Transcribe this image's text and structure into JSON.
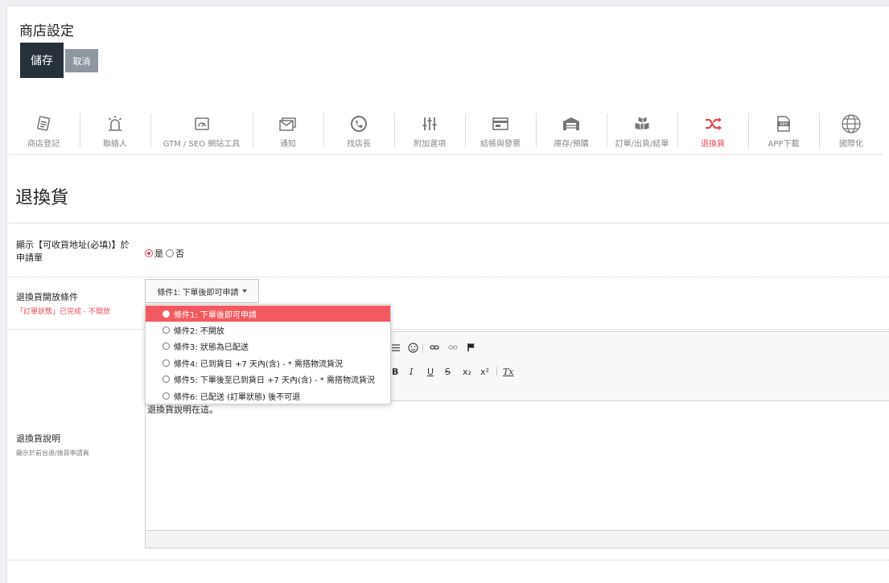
{
  "header": {
    "title": "商店設定",
    "save_label": "儲存",
    "cancel_label": "取消"
  },
  "toolbar": {
    "items": [
      {
        "label": "商店登記",
        "icon": "register-icon"
      },
      {
        "label": "聯絡人",
        "icon": "alarm-icon"
      },
      {
        "label": "GTM / SEO 網站工具",
        "icon": "dashboard-icon"
      },
      {
        "label": "通知",
        "icon": "mail-icon"
      },
      {
        "label": "找店長",
        "icon": "phone-icon"
      },
      {
        "label": "附加選項",
        "icon": "sliders-icon"
      },
      {
        "label": "結帳與發票",
        "icon": "invoice-icon"
      },
      {
        "label": "庫存/預購",
        "icon": "warehouse-icon"
      },
      {
        "label": "訂單/出貨/結單",
        "icon": "boxes-icon"
      },
      {
        "label": "退換貨",
        "icon": "shuffle-icon",
        "active": true
      },
      {
        "label": "APP下載",
        "icon": "app-icon"
      },
      {
        "label": "國際化",
        "icon": "globe-icon"
      }
    ],
    "active_color": "#e84856"
  },
  "section": {
    "title": "退換貨"
  },
  "form": {
    "address_label": "顯示【可收貨地址(必填)】於申請單",
    "yes": "是",
    "no": "否",
    "condition_label": "退換貨開放條件",
    "condition_note": "「訂單狀態」已完成 - 不開放",
    "condition_selected": "條件1: 下單後即可申請",
    "options": [
      "條件1: 下單後即可申請",
      "條件2: 不開放",
      "條件3: 狀態為已配送",
      "條件4: 已到貨日 +7 天內(含) - * 需搭物流貨況",
      "條件5: 下單後至已到貨日 +7 天內(含) - * 需搭物流貨況",
      "條件6: 已配送 (訂單狀態) 後不可退"
    ],
    "description_label": "退換貨說明",
    "description_note": "顯示於前台退/換貨申請頁",
    "editor_content": "退換貨說明在這。"
  },
  "editor_toolbar": {
    "bold": "B",
    "italic": "I",
    "underline": "U",
    "strike": "S",
    "subscript": "x₂",
    "superscript": "x²",
    "clear": "Tx"
  }
}
